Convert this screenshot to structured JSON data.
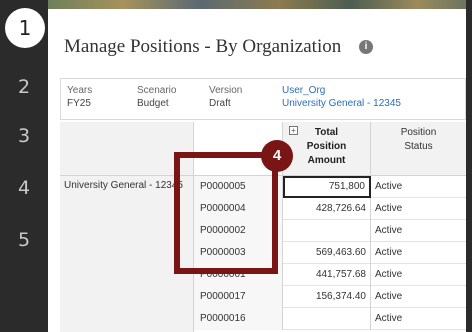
{
  "steps": [
    "1",
    "2",
    "3",
    "4",
    "5"
  ],
  "title": "Manage Positions - By Organization",
  "info_icon": "i",
  "pov": {
    "years_label": "Years",
    "years_value": "FY25",
    "scenario_label": "Scenario",
    "scenario_value": "Budget",
    "version_label": "Version",
    "version_value": "Draft",
    "org_label": "User_Org",
    "org_value": "University General - 12345"
  },
  "grid": {
    "expand_symbol": "+",
    "col_amount_line1": "Total",
    "col_amount_line2": "Position",
    "col_amount_line3": "Amount",
    "col_status_line1": "Position",
    "col_status_line2": "Status",
    "org_row_label": "University General - 12345",
    "rows": [
      {
        "position": "P0000005",
        "amount": "751,800",
        "status": "Active"
      },
      {
        "position": "P0000004",
        "amount": "428,726.64",
        "status": "Active"
      },
      {
        "position": "P0000002",
        "amount": "",
        "status": "Active"
      },
      {
        "position": "P0000003",
        "amount": "569,463.60",
        "status": "Active"
      },
      {
        "position": "P0000001",
        "amount": "441,757.68",
        "status": "Active"
      },
      {
        "position": "P0000017",
        "amount": "156,374.40",
        "status": "Active"
      },
      {
        "position": "P0000016",
        "amount": "",
        "status": "Active"
      }
    ]
  },
  "callout": {
    "number": "4",
    "color": "#7a1515"
  },
  "colors": {
    "rail": "#2b2b2b",
    "link": "#2a6ebb",
    "header_bg": "#f2f2f2"
  }
}
